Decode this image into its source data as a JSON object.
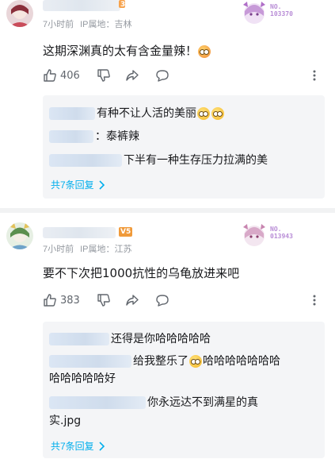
{
  "comments": [
    {
      "level": "3",
      "time": "7小时前",
      "ip": "IP属地：吉林",
      "badge_no": "NO.",
      "badge_num": "103370",
      "text": "这期深渊真的太有含金量辣！",
      "likes": "406",
      "replies": [
        {
          "text": "有种不让人活的美丽"
        },
        {
          "text": "：泰裤辣"
        },
        {
          "text": "下半有一种生存压力拉满的美"
        }
      ],
      "more": "共7条回复"
    },
    {
      "level": "V5",
      "time": "7小时前",
      "ip": "IP属地：江苏",
      "badge_no": "NO.",
      "badge_num": "013943",
      "text": "要不下次把1000抗性的乌龟放进来吧",
      "likes": "383",
      "replies": [
        {
          "text": "还得是你哈哈哈哈哈"
        },
        {
          "text": "给我整乐了",
          "text2": "哈哈哈哈哈哈哈",
          "line2": "哈哈哈哈哈好"
        },
        {
          "text": "你永远达不到满星的真",
          "line2": "实.jpg"
        }
      ],
      "more": "共7条回复"
    }
  ],
  "icons": {
    "like": "thumb-up-icon",
    "dislike": "thumb-down-icon",
    "share": "share-icon",
    "reply": "reply-bubble-icon",
    "more": "more-vertical-icon",
    "chevron": "chevron-right-icon"
  },
  "colors": {
    "accent": "#00aeec",
    "meta": "#9499a0",
    "reply_bg": "#f4f5f7"
  }
}
